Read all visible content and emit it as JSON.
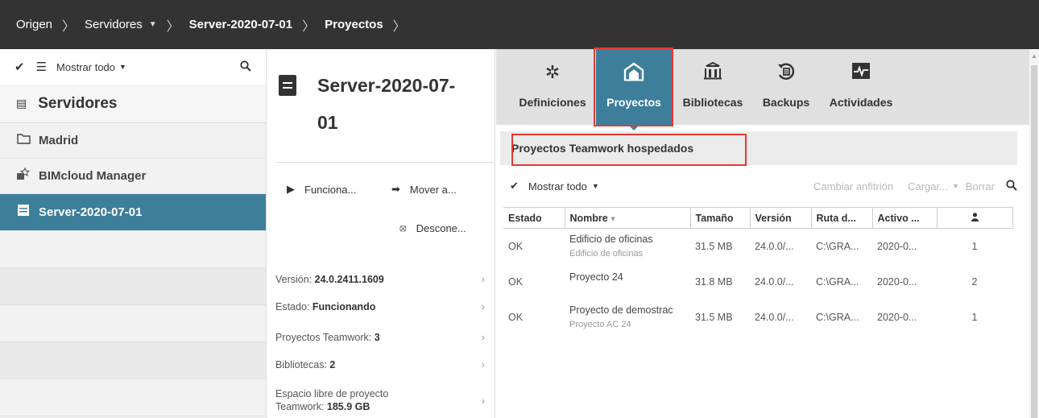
{
  "breadcrumb": {
    "items": [
      {
        "label": "Origen"
      },
      {
        "label": "Servidores"
      },
      {
        "label": "Server-2020-07-01"
      },
      {
        "label": "Proyectos"
      }
    ]
  },
  "sidebar": {
    "toolbar": {
      "filter_label": "Mostrar todo"
    },
    "header": "Servidores",
    "items": [
      {
        "label": "Madrid",
        "icon": "folder-icon"
      },
      {
        "label": "BIMcloud Manager",
        "icon": "manager-icon"
      },
      {
        "label": "Server-2020-07-01",
        "icon": "server-icon",
        "selected": true
      }
    ]
  },
  "middle": {
    "server_name": "Server-2020-07-01",
    "actions": {
      "run": "Funciona...",
      "move": "Mover a...",
      "disconnect": "Descone..."
    },
    "info": [
      {
        "label": "Versión: ",
        "value": "24.0.2411.1609"
      },
      {
        "label": "Estado: ",
        "value": "Funcionando"
      },
      {
        "label": "Proyectos Teamwork: ",
        "value": "3"
      },
      {
        "label": "Bibliotecas: ",
        "value": "2"
      },
      {
        "label_line1": "Espacio libre de proyecto",
        "label_line2": "Teamwork: ",
        "value": "185.9 GB"
      }
    ]
  },
  "tabs": [
    {
      "label": "Definiciones",
      "icon": "gear-icon"
    },
    {
      "label": "Proyectos",
      "icon": "projects-icon",
      "active": true
    },
    {
      "label": "Bibliotecas",
      "icon": "library-icon"
    },
    {
      "label": "Backups",
      "icon": "backup-icon"
    },
    {
      "label": "Actividades",
      "icon": "activity-icon"
    }
  ],
  "section_title": "Proyectos Teamwork hospedados",
  "table_toolbar": {
    "filter_label": "Mostrar todo",
    "change_host": "Cambiar anfitrión",
    "upload": "Cargar...",
    "delete": "Borrar"
  },
  "table": {
    "columns": [
      "Estado",
      "Nombre",
      "Tamaño",
      "Versión",
      "Ruta d...",
      "Activo ...",
      "👤"
    ],
    "rows": [
      {
        "estado": "OK",
        "nombre": "Edificio de oficinas",
        "sub": "Edificio de oficinas",
        "tamano": "31.5 MB",
        "version": "24.0.0/...",
        "ruta": "C:\\GRA...",
        "activo": "2020-0...",
        "users": "1"
      },
      {
        "estado": "OK",
        "nombre": "Proyecto 24",
        "sub": "",
        "tamano": "31.8 MB",
        "version": "24.0.0/...",
        "ruta": "C:\\GRA...",
        "activo": "2020-0...",
        "users": "2"
      },
      {
        "estado": "OK",
        "nombre": "Proyecto de demostrac",
        "sub": "Proyecto AC 24",
        "tamano": "31.5 MB",
        "version": "24.0.0/...",
        "ruta": "C:\\GRA...",
        "activo": "2020-0...",
        "users": "1"
      }
    ]
  },
  "colors": {
    "accent": "#3d7f9b",
    "topbar": "#333333",
    "highlight": "#e53935"
  }
}
